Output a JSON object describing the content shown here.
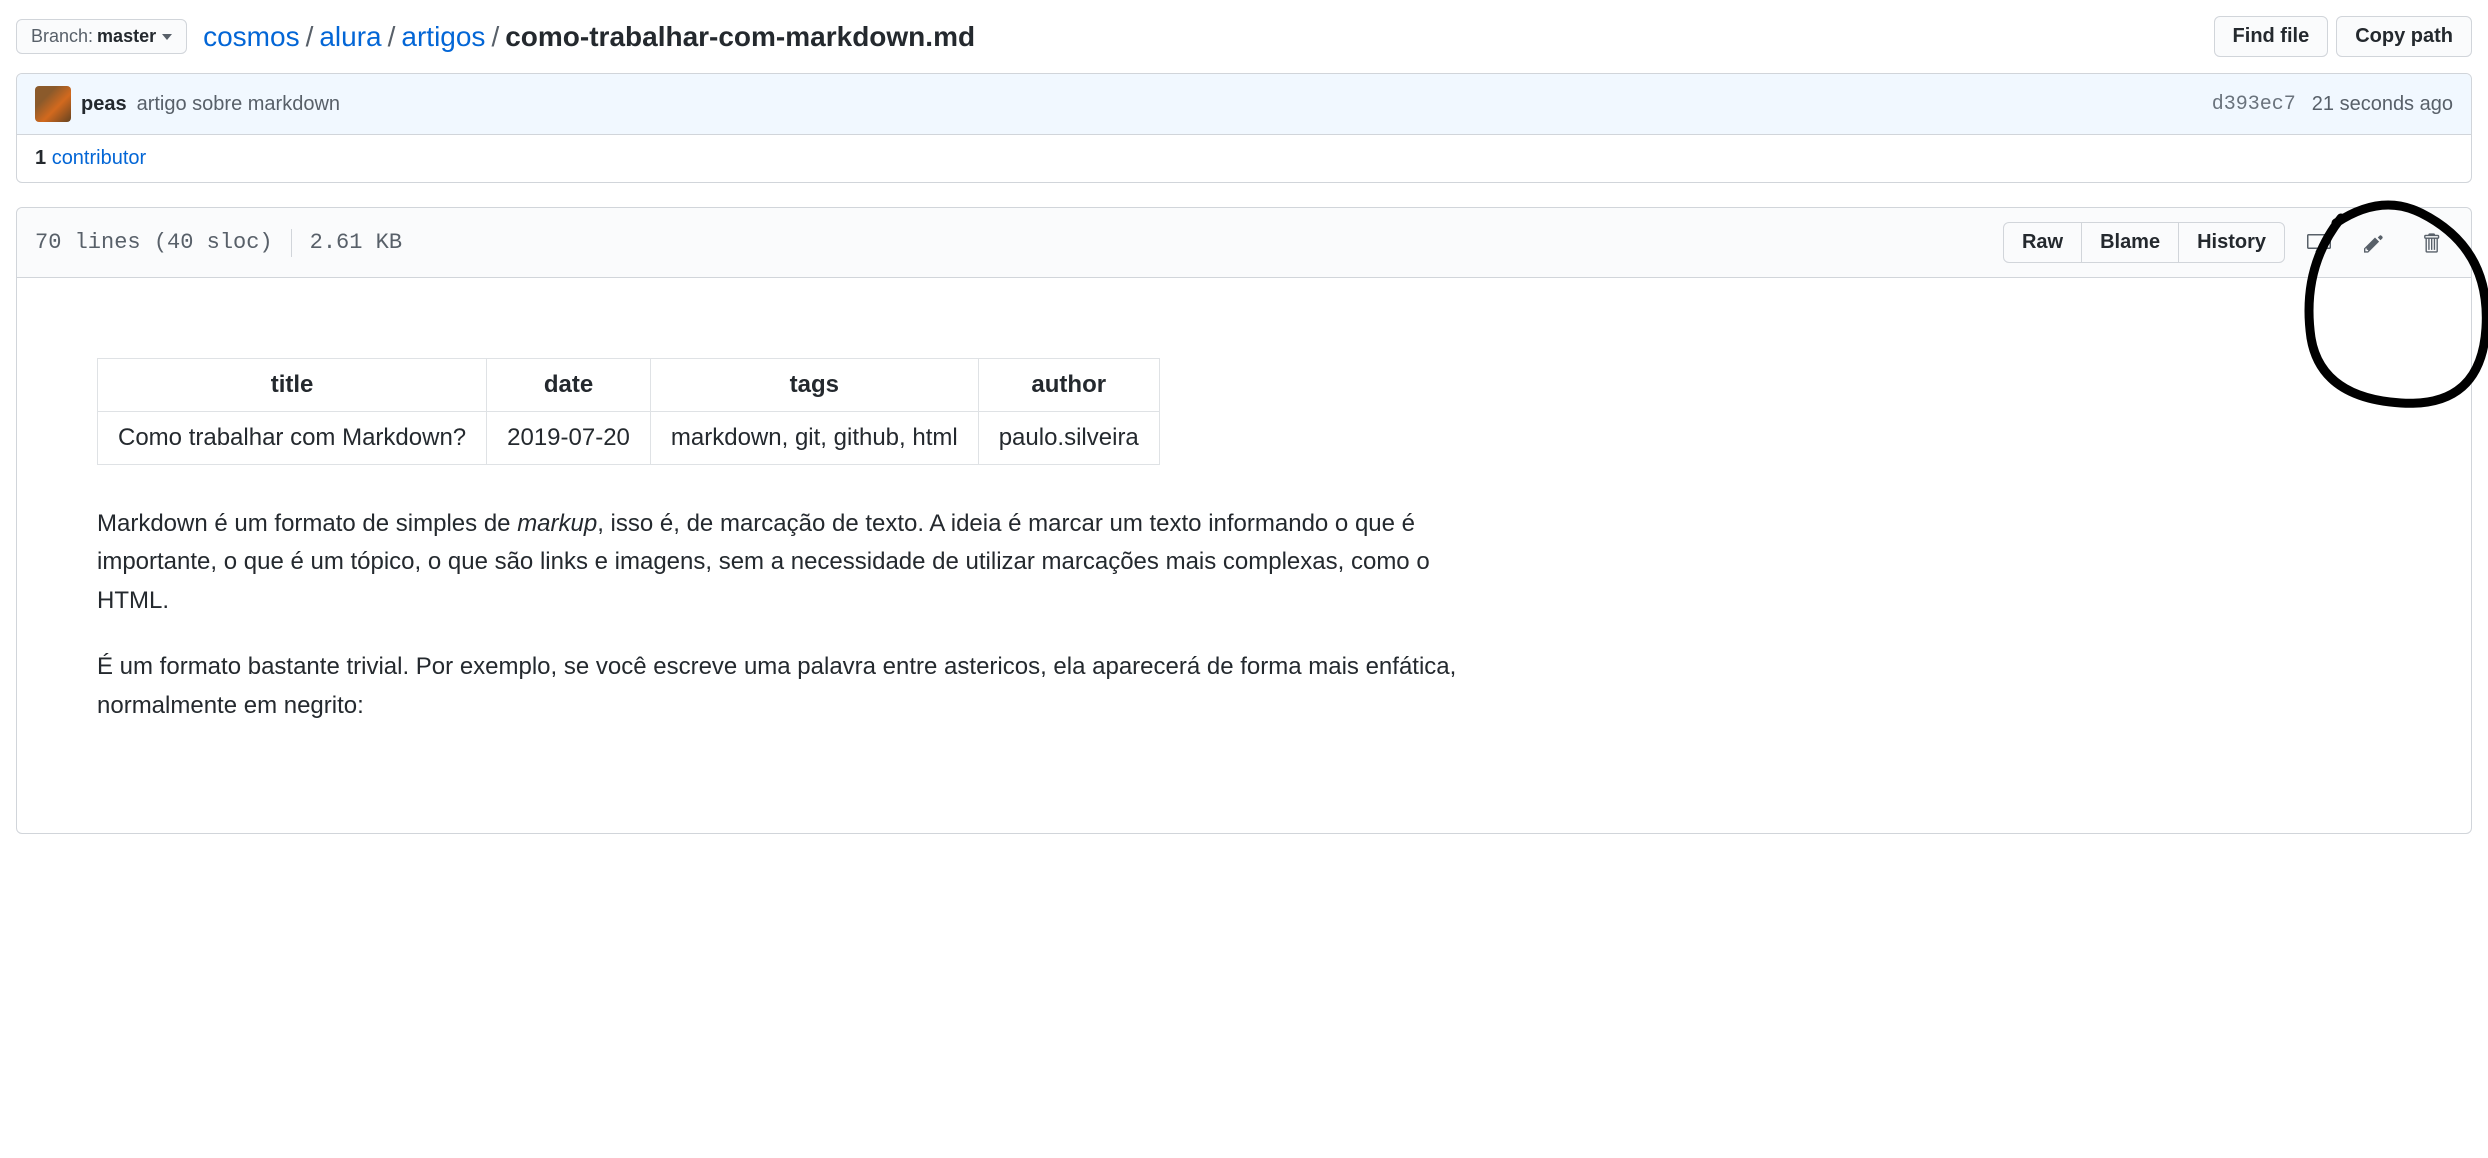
{
  "branch": {
    "label": "Branch:",
    "name": "master"
  },
  "breadcrumb": {
    "parts": [
      "cosmos",
      "alura",
      "artigos"
    ],
    "file": "como-trabalhar-com-markdown.md"
  },
  "actions": {
    "find_file": "Find file",
    "copy_path": "Copy path"
  },
  "commit": {
    "author": "peas",
    "message": "artigo sobre markdown",
    "sha": "d393ec7",
    "time": "21 seconds ago"
  },
  "contributors": {
    "count": "1",
    "label": "contributor"
  },
  "file_stats": {
    "lines": "70 lines (40 sloc)",
    "size": "2.61 KB"
  },
  "file_actions": {
    "raw": "Raw",
    "blame": "Blame",
    "history": "History"
  },
  "metadata": {
    "headers": {
      "title": "title",
      "date": "date",
      "tags": "tags",
      "author": "author"
    },
    "row": {
      "title": "Como trabalhar com Markdown?",
      "date": "2019-07-20",
      "tags": "markdown, git, github, html",
      "author": "paulo.silveira"
    }
  },
  "article": {
    "p1_a": "Markdown é um formato de simples de ",
    "p1_em": "markup",
    "p1_b": ", isso é, de marcação de texto. A ideia é marcar um texto informando o que é importante, o que é um tópico, o que são links e imagens, sem a necessidade de utilizar marcações mais complexas, como o HTML.",
    "p2": "É um formato bastante trivial. Por exemplo, se você escreve uma palavra entre astericos, ela aparecerá de forma mais enfática, normalmente em negrito:"
  }
}
